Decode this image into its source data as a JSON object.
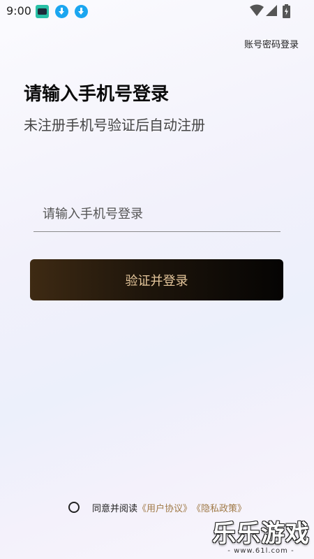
{
  "status_bar": {
    "time": "9:00",
    "notification_icons": [
      "app-notification-icon",
      "download-icon",
      "download-icon"
    ],
    "system_icons": [
      "wifi-icon",
      "signal-icon",
      "battery-charging-icon"
    ]
  },
  "header": {
    "password_login_label": "账号密码登录"
  },
  "main": {
    "title": "请输入手机号登录",
    "subtitle": "未注册手机号验证后自动注册",
    "phone_input": {
      "placeholder": "请输入手机号登录",
      "value": ""
    },
    "verify_button_label": "验证并登录"
  },
  "agreement": {
    "checked": false,
    "prefix": "同意并阅读",
    "user_agreement": "《用户协议》",
    "privacy_policy": "《隐私政策》"
  },
  "watermark": {
    "title": "乐乐游戏",
    "url": "- www.61l.com -"
  },
  "colors": {
    "button_gradient_start": "#3e2a13",
    "button_gradient_end": "#050403",
    "button_text": "#e6c79c",
    "link": "#a07a47"
  }
}
